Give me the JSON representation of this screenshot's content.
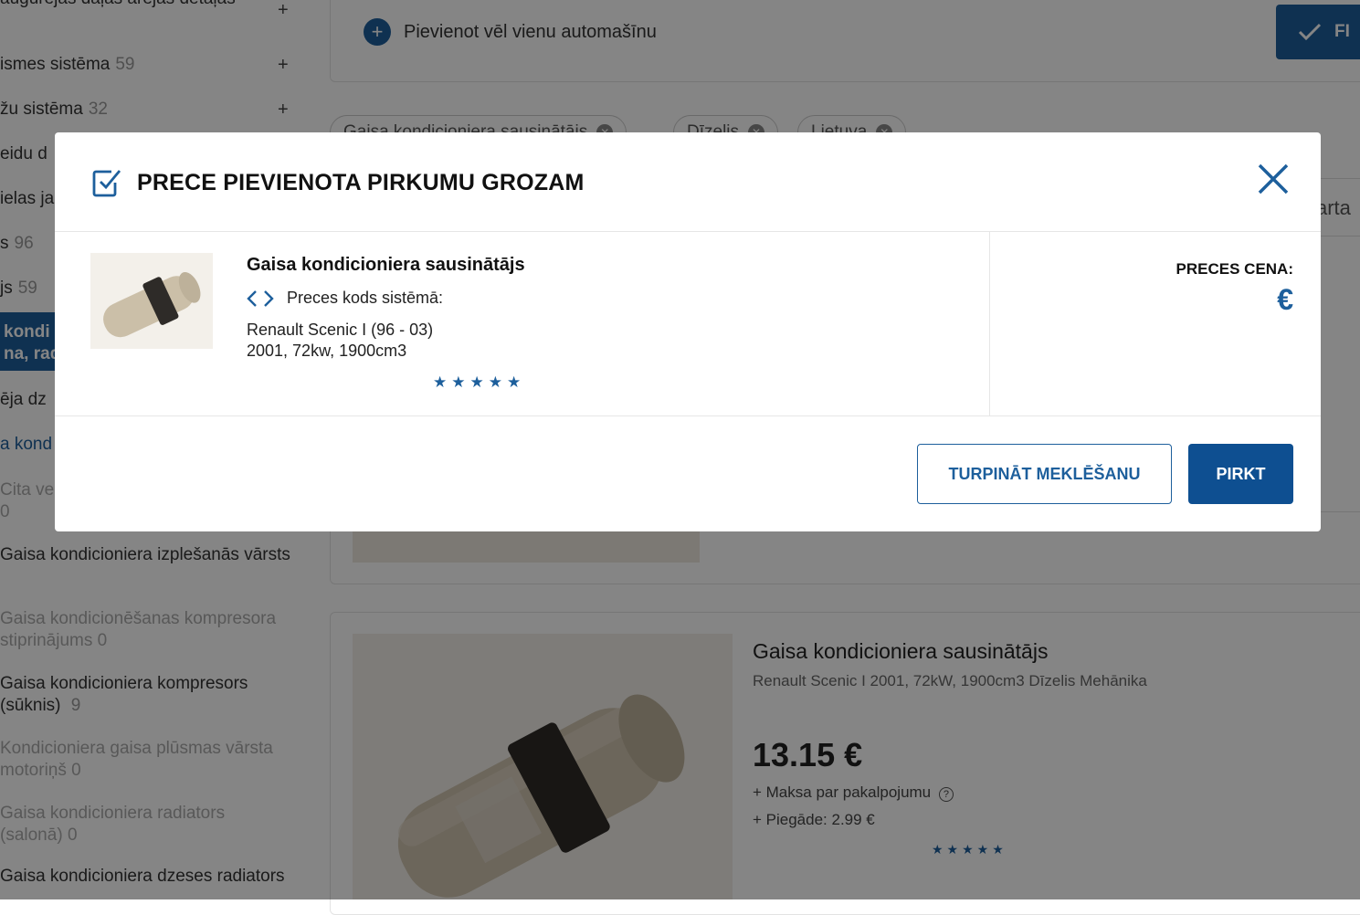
{
  "sidebar": {
    "items": [
      {
        "label": "Augurējās daļas ārējās detaļas",
        "count": ""
      },
      {
        "label": "Pārvadāšanas un kustības vadības sistēma",
        "count": "59"
      },
      {
        "label": "Bremžu sistēma",
        "count": "32"
      },
      {
        "label": "Cita veida d",
        "count": ""
      },
      {
        "label": "Degvielas ja",
        "count": ""
      },
      {
        "label": "Dzinējs",
        "count": "96"
      },
      {
        "label": "Elektrisks",
        "count": "59"
      },
      {
        "label": "Gaisa kondi",
        "count": ""
      },
      {
        "label": "Dzesēšanas sistēma, rad",
        "count": ""
      },
      {
        "label": "Iekšējā dz",
        "count": ""
      },
      {
        "label": "Gaisa kond",
        "count": ""
      },
      {
        "label": "Cita veida",
        "count": "0"
      },
      {
        "label": "Gaisa kondicioniera izplešanās vārsts",
        "count": ""
      },
      {
        "label": "Gaisa kondicionēšanas kompresora stiprinājums",
        "count": "0"
      },
      {
        "label": "Gaisa kondicioniera kompresors (sūknis)",
        "count": "9"
      },
      {
        "label": "Kondicioniera gaisa plūsmas vārsta motoriņš",
        "count": "0"
      },
      {
        "label": "Gaisa kondicioniera radiators (salonā)",
        "count": "0"
      },
      {
        "label": "Gaisa kondicioniera dzeses radiators",
        "count": ""
      }
    ],
    "visible": {
      "row1": "augurējas daļas ārējas detaļas",
      "row2": "ismes sistēma",
      "row2_count": "59",
      "row3": "žu sistēma",
      "row3_count": "32",
      "row4": "eidu d",
      "row5": "ielas ja",
      "row6": "s",
      "row6_count": "96",
      "row7": "js",
      "row7_count": "59",
      "active_line1": "kondi",
      "active_line2": "na, rad",
      "row9": "ēja dz",
      "row10": "a kond",
      "row11": "Cita vei",
      "row11_count": "0",
      "row12": "Gaisa kondicioniera izplešanās vārsts",
      "row12_count": "",
      "row13a": "Gaisa kondicionēšanas kompresora",
      "row13b": "stiprinājums",
      "row13_count": "0",
      "row14a": "Gaisa kondicioniera kompresors",
      "row14b": "(sūknis)",
      "row14_count": "9",
      "row15a": "Kondicioniera gaisa plūsmas vārsta",
      "row15b": "motoriņš",
      "row15_count": "0",
      "row16a": "Gaisa kondicioniera radiators",
      "row16b": "(salonā)",
      "row16_count": "0",
      "row17": "Gaisa kondicioniera dzeses radiators",
      "plus": "+"
    }
  },
  "top": {
    "add_car_label": "Pievienot vēl vienu automašīnu",
    "filter_button_label": "FI"
  },
  "chips": [
    {
      "label": "Gaisa kondicioniera sausinātājs"
    },
    {
      "label": "Dīzelis"
    },
    {
      "label": "Lietuva"
    }
  ],
  "sort_label": "arta",
  "listing": {
    "title": "Gaisa kondicioniera sausinātājs",
    "subtitle": "Renault Scenic I 2001, 72kW, 1900cm3 Dīzelis Mehānika",
    "price": "13.15 €",
    "fee": "+ Maksa par pakalpojumu",
    "shipping": "+ Piegāde: 2.99 €",
    "stars": "★★★★★"
  },
  "modal": {
    "title": "PRECE PIEVIENOTA PIRKUMU GROZAM",
    "item_name": "Gaisa kondicioniera sausinātājs",
    "code_label": "Preces kods sistēmā:",
    "car_model": "Renault Scenic I (96 - 03)",
    "car_specs": "2001, 72kw, 1900cm3",
    "stars": "★★★★★",
    "price_label": "PRECES CENA:",
    "price_value": "€",
    "continue_button": "TURPINĀT MEKLĒŠANU",
    "buy_button": "PIRKT"
  },
  "colors": {
    "accent": "#1d5f9c",
    "buy_button": "#0e4f91",
    "overlay": "rgba(0,0,0,0.48)"
  },
  "icons": {
    "check": "checkbox-check-icon",
    "close": "close-icon",
    "code": "code-brackets-icon",
    "plus": "plus-circle-icon",
    "help": "question-circle-icon"
  }
}
